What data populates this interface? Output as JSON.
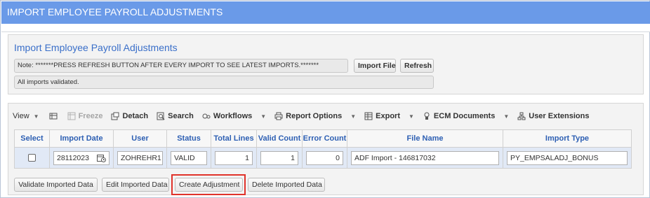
{
  "window": {
    "title": "IMPORT EMPLOYEE PAYROLL ADJUSTMENTS"
  },
  "panel": {
    "title": "Import Employee Payroll Adjustments",
    "note": "Note: *******PRESS REFRESH BUTTON AFTER EVERY IMPORT TO SEE LATEST IMPORTS.*******",
    "status_message": "All imports validated.",
    "import_file_label": "Import File",
    "refresh_label": "Refresh"
  },
  "toolbar": {
    "view": "View",
    "freeze": "Freeze",
    "detach": "Detach",
    "search": "Search",
    "workflows": "Workflows",
    "report_options": "Report Options",
    "export": "Export",
    "ecm_documents": "ECM Documents",
    "user_extensions": "User Extensions"
  },
  "table": {
    "headers": [
      "Select",
      "Import Date",
      "User",
      "Status",
      "Total Lines",
      "Valid Count",
      "Error Count",
      "File Name",
      "Import Type"
    ],
    "rows": [
      {
        "import_date": "28112023",
        "user": "ZOHREHR1",
        "status": "VALID",
        "total_lines": "1",
        "valid_count": "1",
        "error_count": "0",
        "file_name": "ADF Import - 146817032",
        "import_type": "PY_EMPSALADJ_BONUS"
      }
    ]
  },
  "actions": {
    "validate": "Validate Imported Data",
    "edit": "Edit Imported Data",
    "create": "Create Adjustment",
    "delete": "Delete Imported Data"
  },
  "colors": {
    "titlebar": "#6a9ae8",
    "header_text": "#2d5fb3",
    "row_bg": "#e1e9f6",
    "highlight": "#e0332b"
  }
}
